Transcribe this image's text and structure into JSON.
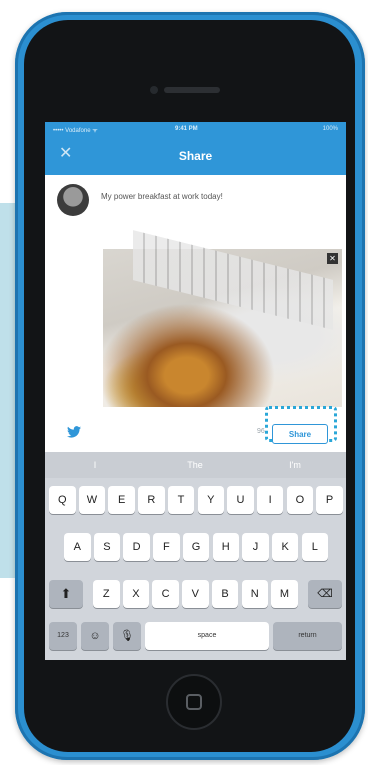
{
  "status_bar": {
    "carrier": "••••• Vodafone ᯤ",
    "time": "9:41 PM",
    "battery": "100%"
  },
  "nav": {
    "close_icon": "✕",
    "title": "Share"
  },
  "post": {
    "message": "My power breakfast at work today!",
    "photo_close_icon": "✕"
  },
  "actions": {
    "char_count": "96",
    "share_label": "Share"
  },
  "keyboard": {
    "suggestions": [
      "I",
      "The",
      "I'm"
    ],
    "row1": [
      "Q",
      "W",
      "E",
      "R",
      "T",
      "Y",
      "U",
      "I",
      "O",
      "P"
    ],
    "row2": [
      "A",
      "S",
      "D",
      "F",
      "G",
      "H",
      "J",
      "K",
      "L"
    ],
    "row3": [
      "Z",
      "X",
      "C",
      "V",
      "B",
      "N",
      "M"
    ],
    "shift_icon": "⬆",
    "backspace_icon": "⌫",
    "numbers_label": "123",
    "emoji_icon": "☺",
    "mic_icon": "🎙",
    "space_label": "space",
    "return_label": "return"
  },
  "colors": {
    "nav_blue": "#2f96d8",
    "phone_blue": "#2b8fd0",
    "highlight": "#2aa7d8"
  }
}
